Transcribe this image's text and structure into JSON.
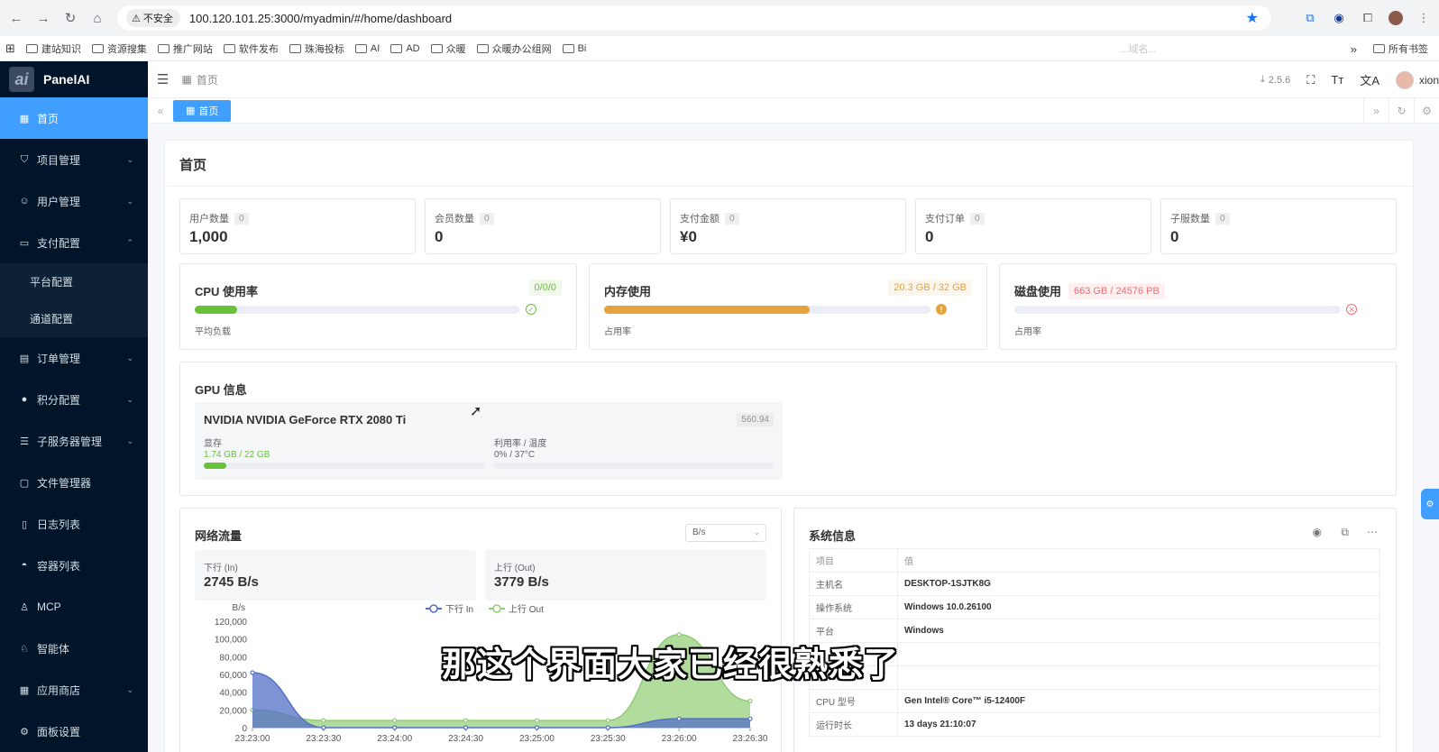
{
  "browser": {
    "insecure_label": "不安全",
    "url": "100.120.101.25:3000/myadmin/#/home/dashboard",
    "bookmarks": [
      "建站知识",
      "资源搜集",
      "推广网站",
      "软件发布",
      "珠海投标",
      "AI",
      "AD",
      "众暖",
      "众暖办公组网",
      "Bi"
    ],
    "bookmarks_faded": [
      "...域名..."
    ],
    "all_bookmarks": "所有书签"
  },
  "sidebar": {
    "logo_text": "PanelAI",
    "items": [
      {
        "label": "首页",
        "icon": "dashboard-icon",
        "glyph": "▦",
        "active": true
      },
      {
        "label": "项目管理",
        "icon": "project-icon",
        "glyph": "⛉",
        "chevron": "⌄"
      },
      {
        "label": "用户管理",
        "icon": "users-icon",
        "glyph": "☺",
        "chevron": "⌄"
      },
      {
        "label": "支付配置",
        "icon": "payment-icon",
        "glyph": "▭",
        "chevron": "⌃"
      },
      {
        "label": "订单管理",
        "icon": "order-icon",
        "glyph": "▤",
        "chevron": "⌄"
      },
      {
        "label": "积分配置",
        "icon": "points-icon",
        "glyph": "●",
        "chevron": "⌄"
      },
      {
        "label": "子服务器管理",
        "icon": "server-icon",
        "glyph": "☰",
        "chevron": "⌄"
      },
      {
        "label": "文件管理器",
        "icon": "folder-icon",
        "glyph": "▢"
      },
      {
        "label": "日志列表",
        "icon": "log-icon",
        "glyph": "▯"
      },
      {
        "label": "容器列表",
        "icon": "container-icon",
        "glyph": "◓"
      },
      {
        "label": "MCP",
        "icon": "mcp-icon",
        "glyph": "♙"
      },
      {
        "label": "智能体",
        "icon": "agent-icon",
        "glyph": "♘"
      },
      {
        "label": "应用商店",
        "icon": "app-store-icon",
        "glyph": "▦",
        "chevron": "⌄"
      },
      {
        "label": "面板设置",
        "icon": "settings-icon",
        "glyph": "⚙"
      }
    ],
    "payment_sub": [
      "平台配置",
      "通道配置"
    ]
  },
  "header": {
    "breadcrumb": "首页",
    "version": "2.5.6",
    "user": "xion"
  },
  "tabs": {
    "active": "首页"
  },
  "main": {
    "title": "首页",
    "stats": [
      {
        "label": "用户数量",
        "badge": "0",
        "value": "1,000"
      },
      {
        "label": "会员数量",
        "badge": "0",
        "value": "0"
      },
      {
        "label": "支付金额",
        "badge": "0",
        "value": "¥0"
      },
      {
        "label": "支付订单",
        "badge": "0",
        "value": "0"
      },
      {
        "label": "子服数量",
        "badge": "0",
        "value": "0"
      }
    ],
    "cpu": {
      "title": "CPU 使用率",
      "tag": "0/0/0",
      "sub": "平均负载",
      "percent": 0.13
    },
    "memory": {
      "title": "内存使用",
      "tag": "20.3 GB / 32 GB",
      "sub": "占用率",
      "percent": 0.63
    },
    "disk": {
      "title": "磁盘使用",
      "tag": "663 GB / 24576 PB",
      "sub": "占用率",
      "percent": 0.0
    },
    "gpu": {
      "title": "GPU 信息",
      "name": "NVIDIA NVIDIA GeForce RTX 2080 Ti",
      "tag": "560.94",
      "mem_label": "显存",
      "mem_value": "1.74 GB / 22 GB",
      "mem_percent": 0.08,
      "util_label": "利用率 / 温度",
      "util_value": "0% / 37°C",
      "util_percent": 0.0
    },
    "network": {
      "title": "网络流量",
      "unit_select": "B/s",
      "down_label": "下行 (In)",
      "down_value": "2745 B/s",
      "up_label": "上行 (Out)",
      "up_value": "3779 B/s"
    },
    "sysinfo": {
      "title": "系统信息",
      "header": [
        "项目",
        "值"
      ],
      "rows": [
        [
          "主机名",
          "DESKTOP-1SJTK8G"
        ],
        [
          "操作系统",
          "Windows 10.0.26100"
        ],
        [
          "平台",
          "Windows"
        ],
        [
          "",
          ""
        ],
        [
          "",
          ""
        ],
        [
          "CPU 型号",
          "Gen Intel® Core™ i5-12400F"
        ],
        [
          "运行时长",
          "13 days 21:10:07"
        ]
      ]
    }
  },
  "chart_data": {
    "type": "area",
    "title": "",
    "xlabel": "",
    "ylabel": "B/s",
    "x": [
      "23:23:00",
      "23:23:30",
      "23:24:00",
      "23:24:30",
      "23:25:00",
      "23:25:30",
      "23:26:00",
      "23:26:30"
    ],
    "ylim": [
      0,
      120000
    ],
    "yticks": [
      0,
      20000,
      40000,
      60000,
      80000,
      100000,
      120000
    ],
    "ytick_labels": [
      "0",
      "20,000",
      "40,000",
      "60,000",
      "80,000",
      "100,000",
      "120,000"
    ],
    "series": [
      {
        "name": "下行 In",
        "color": "#5470c6",
        "values": [
          62000,
          0,
          0,
          0,
          0,
          0,
          10000,
          10000
        ]
      },
      {
        "name": "上行 Out",
        "color": "#91cc75",
        "values": [
          20000,
          8000,
          8000,
          8000,
          8000,
          8000,
          105000,
          30000
        ]
      }
    ],
    "legend": "top-center",
    "grid": false
  },
  "subtitle": "那这个界面大家已经很熟悉了"
}
